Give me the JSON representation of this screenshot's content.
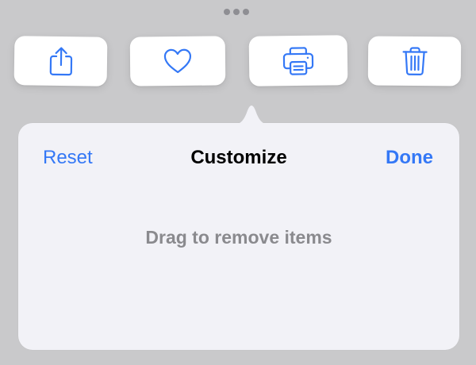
{
  "colors": {
    "background": "#c9c9cb",
    "popover": "#f2f2f7",
    "accent": "#3478f6",
    "hint_text": "#8a8a8e",
    "title_text": "#000000"
  },
  "toolbar": {
    "items": [
      {
        "name": "share",
        "icon": "share-icon"
      },
      {
        "name": "favorite",
        "icon": "heart-icon"
      },
      {
        "name": "print",
        "icon": "printer-icon"
      },
      {
        "name": "delete",
        "icon": "trash-icon"
      }
    ]
  },
  "more_indicator": {
    "icon": "ellipsis-icon"
  },
  "popover": {
    "title": "Customize",
    "reset_label": "Reset",
    "done_label": "Done",
    "hint": "Drag to remove items"
  }
}
